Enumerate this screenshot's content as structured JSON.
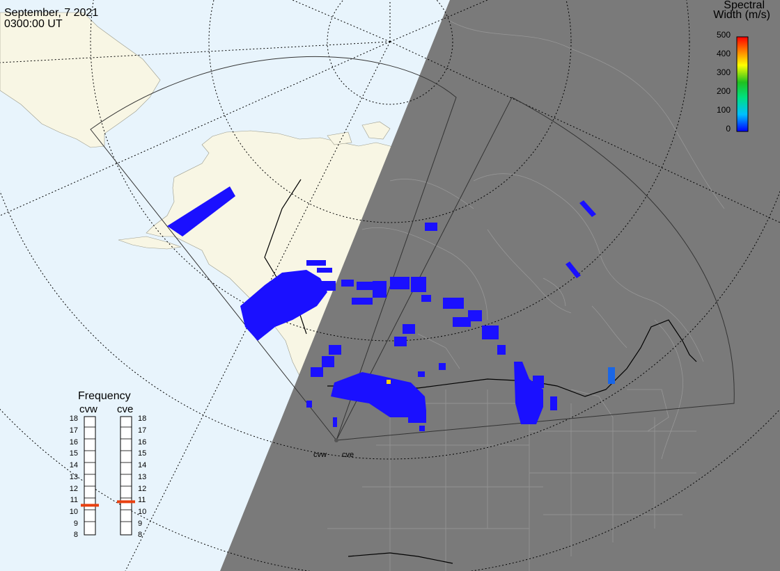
{
  "header": {
    "date": "September, 7 2021",
    "time": "0300:00 UT"
  },
  "colorbar": {
    "title_line1": "Spectral",
    "title_line2": "Width (m/s)",
    "ticks": [
      "500",
      "400",
      "300",
      "200",
      "100",
      "0"
    ],
    "range": [
      0,
      500
    ],
    "colors": [
      "#0000ff",
      "#00c0ff",
      "#00e080",
      "#20c020",
      "#ffff00",
      "#ff8000",
      "#ff0000"
    ]
  },
  "frequency": {
    "title": "Frequency",
    "radars": [
      "cvw",
      "cve"
    ],
    "scale": [
      "18",
      "17",
      "16",
      "15",
      "14",
      "13",
      "12",
      "11",
      "10",
      "9",
      "8"
    ],
    "markers": {
      "cvw": 10.5,
      "cve": 10.8
    },
    "marker_color": "#e84010"
  },
  "sites": {
    "west": "cvw",
    "east": "cve"
  },
  "colors": {
    "ocean": "#e8f4fc",
    "land": "#f8f6e4",
    "night": "#7a7a7a",
    "echo_low": "#1a10ff",
    "echo_mid": "#1a66e6",
    "echo_hi": "#ffd000"
  }
}
